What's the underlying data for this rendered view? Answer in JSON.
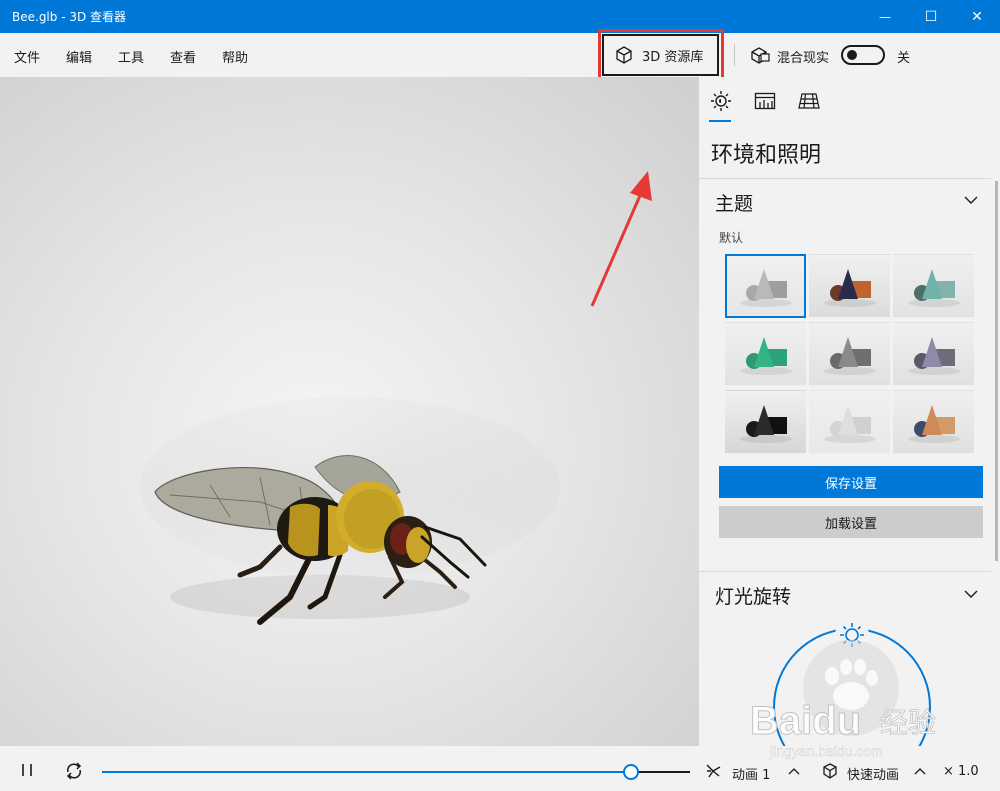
{
  "window": {
    "title": "Bee.glb - 3D 查看器",
    "minimize_glyph": "—",
    "maximize_glyph": "☐",
    "close_glyph": "✕"
  },
  "menu": {
    "items": [
      "文件",
      "编辑",
      "工具",
      "查看",
      "帮助"
    ],
    "assets_button": "3D 资源库",
    "mixed_reality_label": "混合现实",
    "mixed_reality_state": "关"
  },
  "panel": {
    "tabs": [
      "sun-icon",
      "stats-icon",
      "grid-icon"
    ],
    "active_tab": 0,
    "title": "环境和照明",
    "theme_section": {
      "title": "主题",
      "selected_label": "默认",
      "themes": [
        {
          "sphere": "#a8a8a8",
          "cone": "#b9b9b9",
          "box": "#9e9e9e",
          "bg": "#e6e6e6"
        },
        {
          "sphere": "#6b3a2a",
          "cone": "#2a2a4a",
          "box": "#c0642e",
          "bg": "#dcdcdc"
        },
        {
          "sphere": "#4d6f6a",
          "cone": "#6fb2a8",
          "box": "#7fb3ab",
          "bg": "#e2e2e2"
        },
        {
          "sphere": "#2f9a72",
          "cone": "#34b387",
          "box": "#2aa57a",
          "bg": "#e2e2e2"
        },
        {
          "sphere": "#6a6a6a",
          "cone": "#8a8a8a",
          "box": "#6f6f6f",
          "bg": "#e0e0e0"
        },
        {
          "sphere": "#5a5a6a",
          "cone": "#8e8aa8",
          "box": "#6c6c7a",
          "bg": "#e0e0e0"
        },
        {
          "sphere": "#1a1a1a",
          "cone": "#2b2b2b",
          "box": "#111111",
          "bg": "#d6d6d6"
        },
        {
          "sphere": "#d4d4d4",
          "cone": "#dedede",
          "box": "#d0d0d0",
          "bg": "#e8e8e8"
        },
        {
          "sphere": "#3d4c6a",
          "cone": "#d08a5a",
          "box": "#d59a6a",
          "bg": "#e0e0e0"
        }
      ],
      "selected_index": 0,
      "save_label": "保存设置",
      "load_label": "加载设置"
    },
    "light_section": {
      "title": "灯光旋转"
    }
  },
  "bottom": {
    "animation_label": "动画 1",
    "quick_animation_label": "快速动画",
    "speed_label": "× 1.0",
    "timeline_progress": 0.9
  },
  "watermark": {
    "brand": "Baidu",
    "brand_cn": "经验",
    "url": "jingyan.baidu.com"
  },
  "colors": {
    "accent": "#0078d7",
    "highlight": "#e53935"
  }
}
